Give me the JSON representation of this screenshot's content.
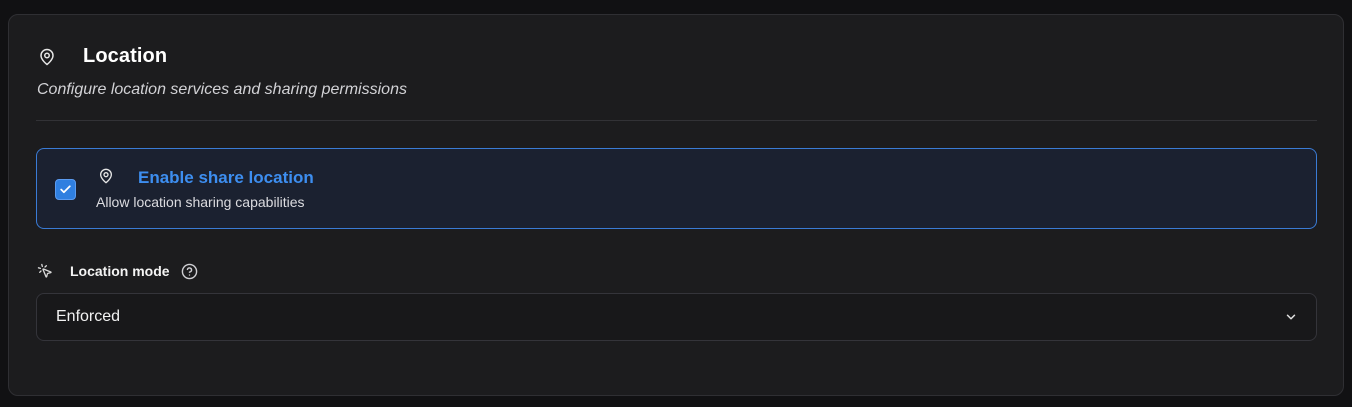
{
  "section": {
    "title": "Location",
    "subtitle": "Configure location services and sharing permissions",
    "icon": "map-pin-icon"
  },
  "share_location": {
    "label": "Enable share location",
    "description": "Allow location sharing capabilities",
    "checked": true,
    "icon": "map-pin-icon",
    "accent_color": "#3d8ef0"
  },
  "location_mode": {
    "label": "Location mode",
    "icon": "pointer-click-icon",
    "help_icon": "help-circle-icon",
    "selected_value": "Enforced"
  }
}
